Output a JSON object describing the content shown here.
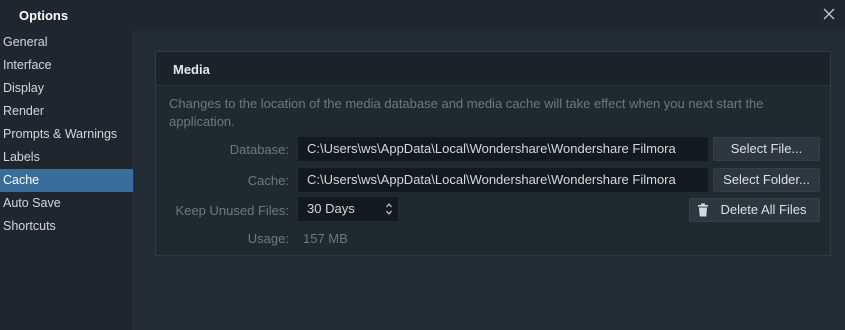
{
  "window": {
    "title": "Options"
  },
  "sidebar": {
    "items": [
      {
        "label": "General"
      },
      {
        "label": "Interface"
      },
      {
        "label": "Display"
      },
      {
        "label": "Render"
      },
      {
        "label": "Prompts & Warnings"
      },
      {
        "label": "Labels"
      },
      {
        "label": "Cache",
        "active": true
      },
      {
        "label": "Auto Save"
      },
      {
        "label": "Shortcuts"
      }
    ]
  },
  "media": {
    "header": "Media",
    "note": "Changes to the location of the media database and media cache will take effect when you next start the application.",
    "database_label": "Database:",
    "database_value": "C:\\Users\\ws\\AppData\\Local\\Wondershare\\Wondershare Filmora",
    "select_file_label": "Select File...",
    "cache_label": "Cache:",
    "cache_value": "C:\\Users\\ws\\AppData\\Local\\Wondershare\\Wondershare Filmora",
    "select_folder_label": "Select Folder...",
    "keep_label": "Keep Unused Files:",
    "keep_value": "30 Days",
    "delete_label": "Delete All Files",
    "usage_label": "Usage:",
    "usage_value": "157 MB"
  },
  "colors": {
    "active_item": "#3a6d9b",
    "background": "#1e272f"
  },
  "icons": [
    "close-icon",
    "trash-icon",
    "stepper-arrows-icon"
  ]
}
